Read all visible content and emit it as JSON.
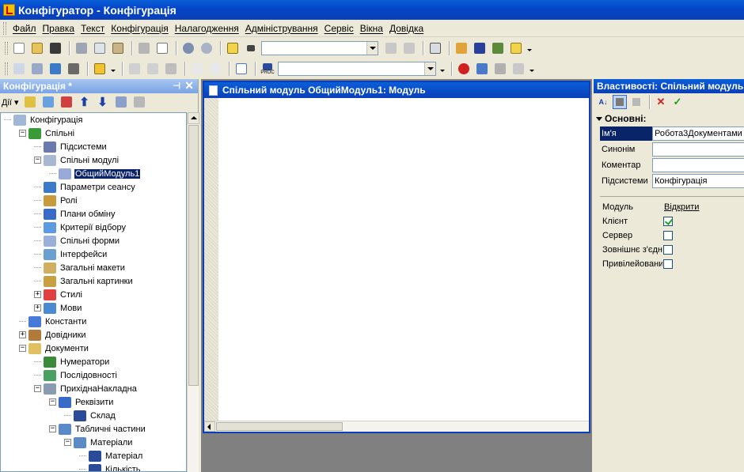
{
  "window": {
    "title": "Конфігуратор - Конфігурація"
  },
  "menu": {
    "items": [
      "Файл",
      "Правка",
      "Текст",
      "Конфігурація",
      "Налагодження",
      "Адміністрування",
      "Сервіс",
      "Вікна",
      "Довідка"
    ]
  },
  "toolbar2": {
    "proc_label": "PROC"
  },
  "left_panel": {
    "title": "Конфігурація *",
    "actions_label": "Дії",
    "tree": [
      {
        "label": "Конфігурація",
        "level": 0,
        "expander": ""
      },
      {
        "label": "Спільні",
        "level": 1,
        "expander": "−"
      },
      {
        "label": "Підсистеми",
        "level": 2,
        "expander": ""
      },
      {
        "label": "Спільні модулі",
        "level": 2,
        "expander": "−"
      },
      {
        "label": "ОбщийМодуль1",
        "level": 3,
        "expander": "",
        "selected": true
      },
      {
        "label": "Параметри сеансу",
        "level": 2,
        "expander": ""
      },
      {
        "label": "Ролі",
        "level": 2,
        "expander": ""
      },
      {
        "label": "Плани обміну",
        "level": 2,
        "expander": ""
      },
      {
        "label": "Критерії відбору",
        "level": 2,
        "expander": ""
      },
      {
        "label": "Спільні форми",
        "level": 2,
        "expander": ""
      },
      {
        "label": "Інтерфейси",
        "level": 2,
        "expander": ""
      },
      {
        "label": "Загальні макети",
        "level": 2,
        "expander": ""
      },
      {
        "label": "Загальні картинки",
        "level": 2,
        "expander": ""
      },
      {
        "label": "Стилі",
        "level": 2,
        "expander": "+"
      },
      {
        "label": "Мови",
        "level": 2,
        "expander": "+"
      },
      {
        "label": "Константи",
        "level": 1,
        "expander": ""
      },
      {
        "label": "Довідники",
        "level": 1,
        "expander": "+"
      },
      {
        "label": "Документи",
        "level": 1,
        "expander": "−"
      },
      {
        "label": "Нумератори",
        "level": 2,
        "expander": ""
      },
      {
        "label": "Послідовності",
        "level": 2,
        "expander": ""
      },
      {
        "label": "ПрихіднаНакладна",
        "level": 2,
        "expander": "−"
      },
      {
        "label": "Реквізити",
        "level": 3,
        "expander": "−"
      },
      {
        "label": "Склад",
        "level": 4,
        "expander": ""
      },
      {
        "label": "Табличні частини",
        "level": 3,
        "expander": "−"
      },
      {
        "label": "Матеріали",
        "level": 4,
        "expander": "−"
      },
      {
        "label": "Матеріал",
        "level": 5,
        "expander": ""
      },
      {
        "label": "Кількість",
        "level": 5,
        "expander": ""
      }
    ]
  },
  "editor": {
    "title": "Спільний модуль ОбщийМодуль1: Модуль"
  },
  "properties": {
    "title": "Властивості: Спільний модуль",
    "section": "Основні:",
    "rows": [
      {
        "name": "Ім'я",
        "value": "Робота3Документами"
      },
      {
        "name": "Синонім",
        "value": ""
      },
      {
        "name": "Коментар",
        "value": ""
      },
      {
        "name": "Підсистеми",
        "value": "Конфігурація"
      }
    ],
    "module_label": "Модуль",
    "module_link": "Відкрити",
    "options": [
      {
        "name": "Клієнт",
        "checked": true
      },
      {
        "name": "Сервер",
        "checked": false
      },
      {
        "name": "Зовнішнє з'єднання",
        "checked": false
      },
      {
        "name": "Привілейований",
        "checked": false
      }
    ]
  },
  "colors": {
    "titlebar": "#0546c9",
    "selection": "#0a246a",
    "panel_bg": "#ece9d8",
    "mdi_bg": "#808080"
  }
}
